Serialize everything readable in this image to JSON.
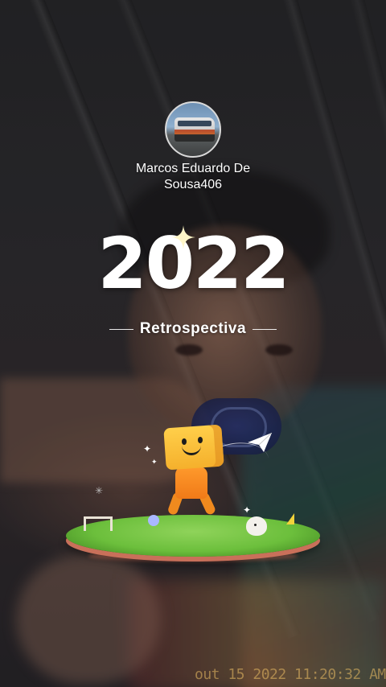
{
  "profile": {
    "name_line1": "Marcos Eduardo De",
    "name_line2": "Sousa406",
    "avatar_icon": "bus-photo-avatar"
  },
  "headline": {
    "year": "2022",
    "subtitle": "Retrospectiva"
  },
  "photo": {
    "timestamp": "out 15 2022 11:20:32 AM"
  },
  "colors": {
    "text": "#ffffff",
    "grass": "#6cbf3c",
    "character": "#ffcf4a",
    "character_body": "#f07a18"
  },
  "icons": {
    "sparkle": "sparkle-icon",
    "paper_plane": "paper-plane-icon"
  }
}
